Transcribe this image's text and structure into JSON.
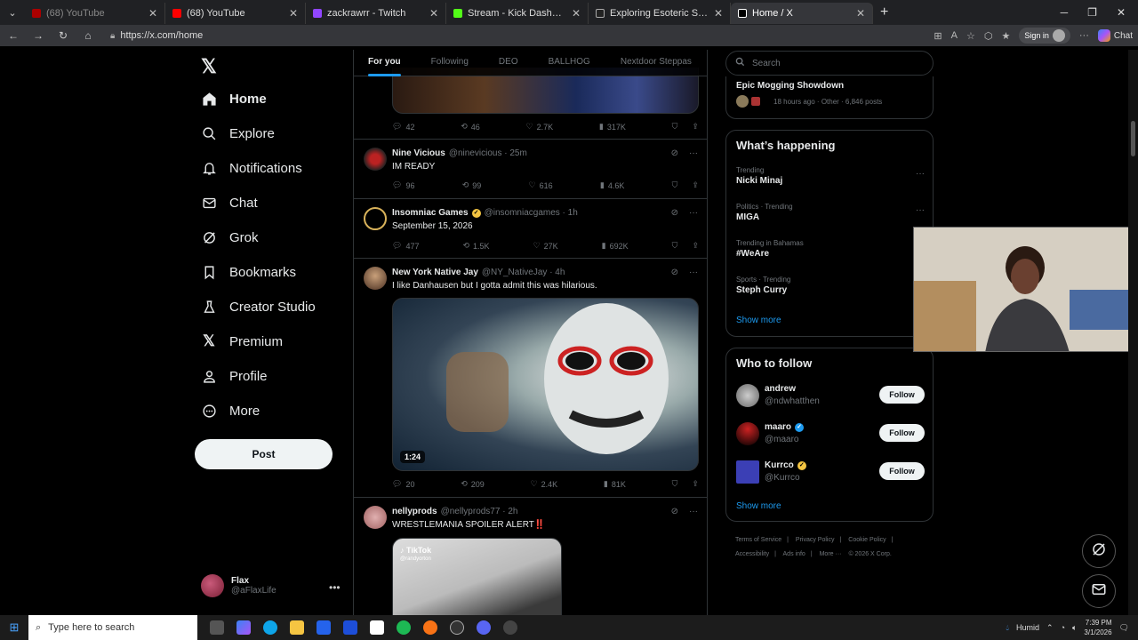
{
  "browser": {
    "tabs": [
      {
        "title": "(68) YouTube",
        "color": "#ff0000",
        "active": false,
        "dim": true
      },
      {
        "title": "(68) YouTube",
        "color": "#ff0000",
        "active": false,
        "dim": false
      },
      {
        "title": "zackrawrr - Twitch",
        "color": "#9146ff",
        "active": false,
        "dim": false
      },
      {
        "title": "Stream - Kick Dashboard",
        "color": "#53fc18",
        "active": false,
        "dim": false
      },
      {
        "title": "Exploring Esoteric Symbolism in M",
        "color": "#ffffff",
        "active": false,
        "dim": false
      },
      {
        "title": "Home / X",
        "color": "#ffffff",
        "active": true,
        "dim": false
      }
    ],
    "url": "https://x.com/home",
    "signin_label": "Sign in",
    "chat_label": "Chat"
  },
  "nav": {
    "items": [
      {
        "label": "Home",
        "icon": "home-icon"
      },
      {
        "label": "Explore",
        "icon": "search-icon"
      },
      {
        "label": "Notifications",
        "icon": "bell-icon"
      },
      {
        "label": "Chat",
        "icon": "mail-icon"
      },
      {
        "label": "Grok",
        "icon": "grok-icon"
      },
      {
        "label": "Bookmarks",
        "icon": "bookmark-icon"
      },
      {
        "label": "Creator Studio",
        "icon": "creator-studio-icon"
      },
      {
        "label": "Premium",
        "icon": "x-icon"
      },
      {
        "label": "Profile",
        "icon": "person-icon"
      },
      {
        "label": "More",
        "icon": "more-circle-icon"
      }
    ],
    "post_label": "Post",
    "account": {
      "name": "Flax",
      "handle": "@aFlaxLife"
    }
  },
  "feed": {
    "tabs": [
      "For you",
      "Following",
      "DEO",
      "BALLHOG",
      "Nextdoor Steppas"
    ],
    "top_actions": {
      "replies": "42",
      "reposts": "46",
      "likes": "2.7K",
      "views": "317K"
    },
    "tweets": [
      {
        "name": "Nine Vicious",
        "handle": "@ninevicious · 25m",
        "text": "IM READY",
        "replies": "96",
        "reposts": "99",
        "likes": "616",
        "views": "4.6K"
      },
      {
        "name": "Insomniac Games",
        "handle": "@insomniacgames · 1h",
        "text": "September 15, 2026",
        "replies": "477",
        "reposts": "1.5K",
        "likes": "27K",
        "views": "692K"
      },
      {
        "name": "New York Native Jay",
        "handle": "@NY_NativeJay · 4h",
        "text": "I like Danhausen but I gotta admit this was hilarious.",
        "duration": "1:24",
        "replies": "20",
        "reposts": "209",
        "likes": "2.4K",
        "views": "81K"
      },
      {
        "name": "nellyprods",
        "handle": "@nellyprods77 · 2h",
        "text": "WRESTLEMANIA SPOILER ALERT‼️",
        "media_label": "TikTok",
        "media_sub": "@randyorton"
      }
    ]
  },
  "right": {
    "search_placeholder": "Search",
    "top_event": {
      "name": "Epic Mogging Showdown",
      "meta": "18 hours ago · Other · 6,846 posts"
    },
    "whats_happening_title": "What’s happening",
    "trends": [
      {
        "meta": "Trending",
        "name": "Nicki Minaj"
      },
      {
        "meta": "Politics · Trending",
        "name": "MIGA"
      },
      {
        "meta": "Trending in Bahamas",
        "name": "#WeAre"
      },
      {
        "meta": "Sports · Trending",
        "name": "Steph Curry"
      }
    ],
    "show_more": "Show more",
    "who_to_follow_title": "Who to follow",
    "follow": [
      {
        "name": "andrew",
        "handle": "@ndwhatthen",
        "badge": "none"
      },
      {
        "name": "maaro",
        "handle": "@maaro",
        "badge": "blue"
      },
      {
        "name": "Kurrco",
        "handle": "@Kurrco",
        "badge": "gold"
      }
    ],
    "follow_label": "Follow",
    "footer": [
      "Terms of Service",
      "|",
      "Privacy Policy",
      "|",
      "Cookie Policy",
      "|",
      "Accessibility",
      "|",
      "Ads info",
      "|",
      "More ···",
      "© 2026 X Corp."
    ]
  },
  "taskbar": {
    "search_placeholder": "Type here to search",
    "weather": "Humid",
    "time": "7:39 PM",
    "date": "3/1/2026"
  }
}
